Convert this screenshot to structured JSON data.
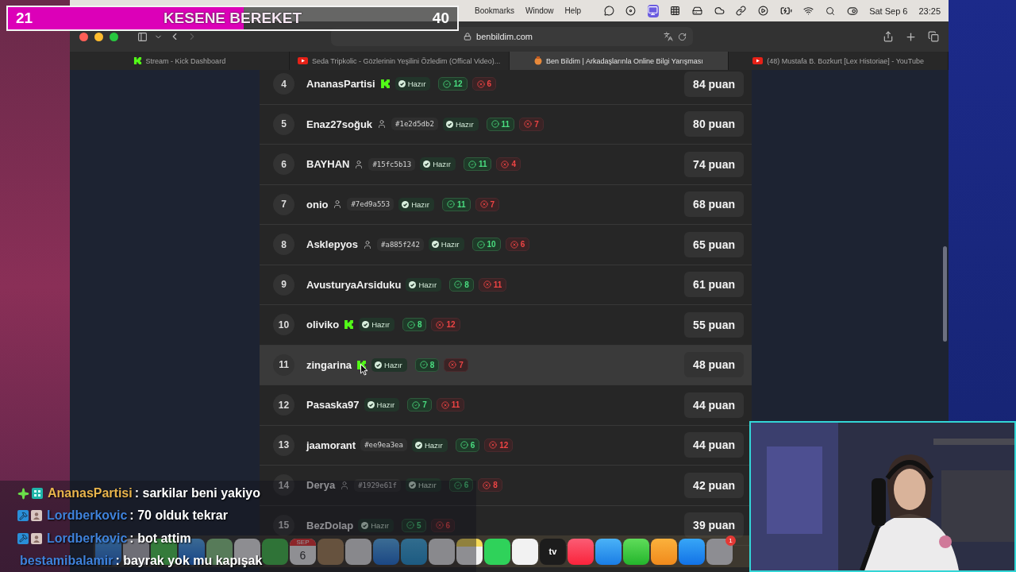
{
  "goal": {
    "current": "21",
    "title": "KESENE BEREKET",
    "target": "40",
    "level": 0.525
  },
  "menu_bar": {
    "items": [
      "Bookmarks",
      "Window",
      "Help"
    ],
    "date": "Sat Sep 6",
    "time": "23:25"
  },
  "browser": {
    "address": "benbildim.com",
    "tabs": [
      {
        "title": "Stream - Kick Dashboard",
        "kind": "kick",
        "selected": false
      },
      {
        "title": "Seda Tripkolic - Gözlerinin Yeşilini Özledim (Offical Video)...",
        "kind": "video",
        "selected": false
      },
      {
        "title": "Ben Bildim | Arkadaşlarınla Online Bilgi Yarışması",
        "kind": "site",
        "selected": true
      },
      {
        "title": "(48) Mustafa B. Bozkurt [Lex Historiae] - YouTube",
        "kind": "video",
        "selected": false
      }
    ]
  },
  "leaderboard": {
    "rows": [
      {
        "rank": "4",
        "name": "AnanasPartisi",
        "kind": "kick",
        "status": "Hazır",
        "correct": "12",
        "wrong": "6",
        "score": "84 puan",
        "highlighted": false
      },
      {
        "rank": "5",
        "name": "Enaz27soğuk",
        "kind": "guest",
        "tag": "#1e2d5db2",
        "status": "Hazır",
        "correct": "11",
        "wrong": "7",
        "score": "80 puan",
        "highlighted": false
      },
      {
        "rank": "6",
        "name": "BAYHAN",
        "kind": "guest",
        "tag": "#15fc5b13",
        "status": "Hazır",
        "correct": "11",
        "wrong": "4",
        "score": "74 puan",
        "highlighted": false
      },
      {
        "rank": "7",
        "name": "onio",
        "kind": "guest",
        "tag": "#7ed9a553",
        "status": "Hazır",
        "correct": "11",
        "wrong": "7",
        "score": "68 puan",
        "highlighted": false
      },
      {
        "rank": "8",
        "name": "Asklepyos",
        "kind": "guest",
        "tag": "#a885f242",
        "status": "Hazır",
        "correct": "10",
        "wrong": "6",
        "score": "65 puan",
        "highlighted": false
      },
      {
        "rank": "9",
        "name": "AvusturyaArsiduku",
        "kind": "plain",
        "status": "Hazır",
        "correct": "8",
        "wrong": "11",
        "score": "61 puan",
        "highlighted": false
      },
      {
        "rank": "10",
        "name": "oliviko",
        "kind": "kick",
        "status": "Hazır",
        "correct": "8",
        "wrong": "12",
        "score": "55 puan",
        "highlighted": false
      },
      {
        "rank": "11",
        "name": "zingarina",
        "kind": "kick",
        "status": "Hazır",
        "correct": "8",
        "wrong": "7",
        "score": "48 puan",
        "highlighted": true
      },
      {
        "rank": "12",
        "name": "Pasaska97",
        "kind": "plain",
        "status": "Hazır",
        "correct": "7",
        "wrong": "11",
        "score": "44 puan",
        "highlighted": false
      },
      {
        "rank": "13",
        "name": "jaamorant",
        "kind": "plain",
        "tag": "#ee9ea3ea",
        "status": "Hazır",
        "correct": "6",
        "wrong": "12",
        "score": "44 puan",
        "highlighted": false
      },
      {
        "rank": "14",
        "name": "Derya",
        "kind": "guest",
        "tag": "#1929e61f",
        "status": "Hazır",
        "correct": "6",
        "wrong": "8",
        "score": "42 puan",
        "highlighted": false
      },
      {
        "rank": "15",
        "name": "BezDolap",
        "kind": "plain",
        "status": "Hazır",
        "correct": "5",
        "wrong": "6",
        "score": "39 puan",
        "highlighted": false
      }
    ]
  },
  "dock": {
    "calendar_month": "SEP",
    "calendar_day": "6",
    "tv_label": "tv",
    "settings_badge": "1"
  },
  "chat": [
    {
      "user": "AnanasPartisi",
      "color": "#e8b44c",
      "badges": [
        {
          "kind": "sparkle"
        },
        {
          "kind": "og"
        }
      ],
      "message": ": sarkilar beni yakiyo"
    },
    {
      "user": "Lordberkovic",
      "color": "#3f82db",
      "badges": [
        {
          "kind": "mod"
        },
        {
          "kind": "avatar"
        }
      ],
      "message": ": 70 olduk tekrar"
    },
    {
      "user": "Lordberkovic",
      "color": "#3f82db",
      "badges": [
        {
          "kind": "mod"
        },
        {
          "kind": "avatar"
        }
      ],
      "message": ": bot attim"
    },
    {
      "user": "bestamibalamir",
      "color": "#3f82db",
      "message": ": bayrak yok mu kapışak"
    }
  ]
}
